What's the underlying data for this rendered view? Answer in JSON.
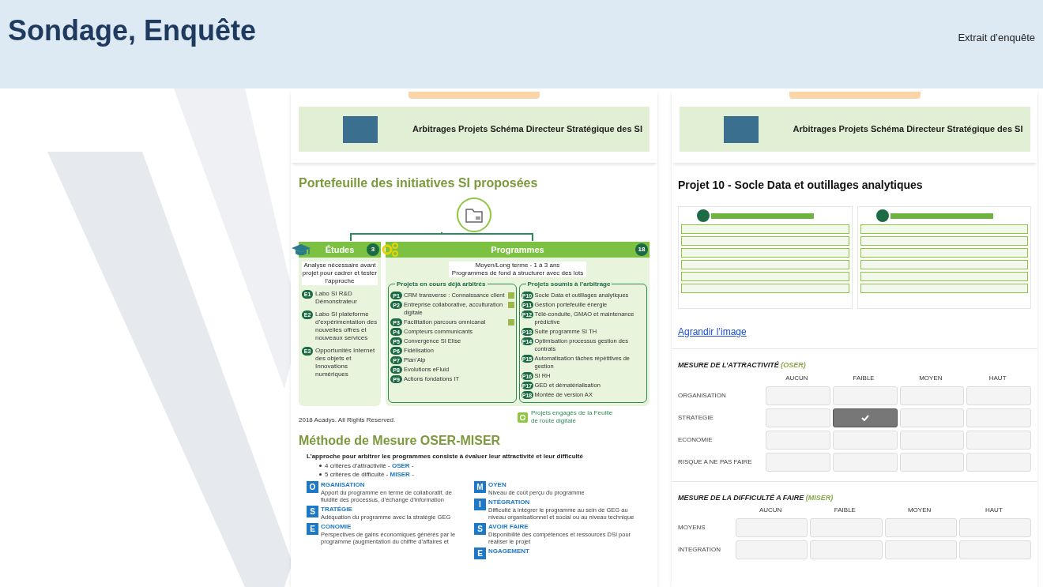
{
  "header": {
    "title": "Sondage, Enquête",
    "subtitle": "Extrait d’enquête"
  },
  "left_panel": {
    "banner": {
      "title": "Arbitrages Projets Schéma Directeur Stratégique des SI"
    },
    "portfolio": {
      "title": "Portefeuille des initiatives SI proposées",
      "etudes": {
        "label": "Études",
        "count": "3",
        "description": "Analyse nécessaire avant projet pour cadrer et tester l’approche",
        "items": [
          {
            "code": "E1",
            "label": "Labo SI R&D Démonstrateur"
          },
          {
            "code": "E2",
            "label": "Labo SI plateforme d’expérimentation des nouvelles offres et nouveaux services"
          },
          {
            "code": "E3",
            "label": "Opportunités Internet des objets et Innovations numériques"
          }
        ]
      },
      "programmes": {
        "label": "Programmes",
        "count": "18",
        "description": [
          "Moyen/Long terme - 1 à 3 ans",
          "Programmes de fond à structurer avec des lots"
        ],
        "groups": [
          {
            "title": "Projets en cours déjà arbitrés",
            "items": [
              {
                "code": "P1",
                "label": "CRM transverse : Connaissance client",
                "digital": true
              },
              {
                "code": "P2",
                "label": "Entreprise collaborative, acculturation digitale",
                "digital": true
              },
              {
                "code": "P3",
                "label": "Facilitation parcours omnicanal",
                "digital": true
              },
              {
                "code": "P4",
                "label": "Compteurs communicants",
                "digital": false
              },
              {
                "code": "P5",
                "label": "Convergence SI Elise",
                "digital": false
              },
              {
                "code": "P6",
                "label": "Fidélisation",
                "digital": false
              },
              {
                "code": "P7",
                "label": "Plan’Alp",
                "digital": false
              },
              {
                "code": "P8",
                "label": "Evolutions eFluid",
                "digital": false
              },
              {
                "code": "P9",
                "label": "Actions fondations IT",
                "digital": false
              }
            ]
          },
          {
            "title": "Projets soumis à l’arbitrage",
            "items": [
              {
                "code": "P10",
                "label": "Socle Data et outillages analytiques",
                "digital": false
              },
              {
                "code": "P11",
                "label": "Gestion portefeuille énergie",
                "digital": false
              },
              {
                "code": "P12",
                "label": "Télé-conduite, GMAO et maintenance prédictive",
                "digital": false
              },
              {
                "code": "P13",
                "label": "Suite programme SI TH",
                "digital": false
              },
              {
                "code": "P14",
                "label": "Optimisation processus gestion des contrats",
                "digital": false
              },
              {
                "code": "P15",
                "label": "Automatisation tâches répétitives de gestion",
                "digital": false
              },
              {
                "code": "P16",
                "label": "SI RH",
                "digital": false
              },
              {
                "code": "P17",
                "label": "GED et dématérialisation",
                "digital": false
              },
              {
                "code": "P18",
                "label": "Montée de version AX",
                "digital": false
              }
            ]
          }
        ]
      },
      "copyright": "2018 Acadys. All Rights Reserved.",
      "legend": "Projets engagés de la Feuille de route digitale"
    },
    "method": {
      "title": "Méthode de Mesure OSER-MISER",
      "intro": "L’approche pour arbitrer les programmes consiste à évaluer leur attractivité et leur difficulté",
      "bullets": [
        {
          "text": "4 critères d’attractivité - ",
          "acronym": "OSER",
          "suffix": " -"
        },
        {
          "text": "5 critères de difficulté - ",
          "acronym": "MISER",
          "suffix": " -"
        }
      ],
      "columns": [
        [
          {
            "letter": "O",
            "word": "RGANISATION",
            "description": "Apport du programme en terme de collaboratif, de fluidité des processus, d’échange d’information"
          },
          {
            "letter": "S",
            "word": "TRATÉGIE",
            "description": "Adéquation du programme avec la stratégie GEG"
          },
          {
            "letter": "E",
            "word": "CONOMIE",
            "description": "Perspectives de gains économiques générés par le programme (augmentation du chiffre d’affaires et"
          }
        ],
        [
          {
            "letter": "M",
            "word": "OYEN",
            "description": "Niveau de coût perçu du programme"
          },
          {
            "letter": "I",
            "word": "NTÉGRATION",
            "description": "Difficulté à intégrer le programme au sein de GEG au niveau organisationnel et social ou au niveau technique"
          },
          {
            "letter": "S",
            "word": "AVOIR FAIRE",
            "description": "Disponibilité des compétences et ressources DSI pour réaliser le projet"
          },
          {
            "letter": "E",
            "word": "NGAGEMENT"
          }
        ]
      ]
    }
  },
  "right_panel": {
    "banner": {
      "title": "Arbitrages Projets Schéma Directeur Stratégique des SI"
    },
    "project_title": "Projet 10 - Socle Data et outillages analytiques",
    "enlarge_link": "Agrandir l’image",
    "measures": [
      {
        "title": "MESURE DE L’ATTRACTIVITÉ",
        "tag": "(OSER)",
        "columns": [
          "AUCUN",
          "FAIBLE",
          "MOYEN",
          "HAUT"
        ],
        "rows": [
          {
            "label": "ORGANISATION",
            "cells": [
              {
                "selected": false
              },
              {
                "selected": false
              },
              {
                "selected": false
              },
              {
                "selected": false
              }
            ]
          },
          {
            "label": "STRATEGIE",
            "cells": [
              {
                "selected": false
              },
              {
                "selected": true
              },
              {
                "selected": false
              },
              {
                "selected": false
              }
            ]
          },
          {
            "label": "ECONOMIE",
            "cells": [
              {
                "selected": false
              },
              {
                "selected": false
              },
              {
                "selected": false
              },
              {
                "selected": false
              }
            ]
          },
          {
            "label": "RISQUE A NE PAS FAIRE",
            "cells": [
              {
                "selected": false
              },
              {
                "selected": false
              },
              {
                "selected": false
              },
              {
                "selected": false
              }
            ]
          }
        ]
      },
      {
        "title": "MESURE DE LA DIFFICULTÉ A FAIRE",
        "tag": "(MISER)",
        "columns": [
          "AUCUN",
          "FAIBLE",
          "MOYEN",
          "HAUT"
        ],
        "rows": [
          {
            "label": "MOYENS",
            "cells": [
              {
                "selected": false
              },
              {
                "selected": false
              },
              {
                "selected": false
              },
              {
                "selected": false
              }
            ]
          },
          {
            "label": "INTEGRATION",
            "cells": [
              {
                "selected": false
              },
              {
                "selected": false
              },
              {
                "selected": false
              },
              {
                "selected": false
              }
            ]
          }
        ]
      }
    ]
  }
}
